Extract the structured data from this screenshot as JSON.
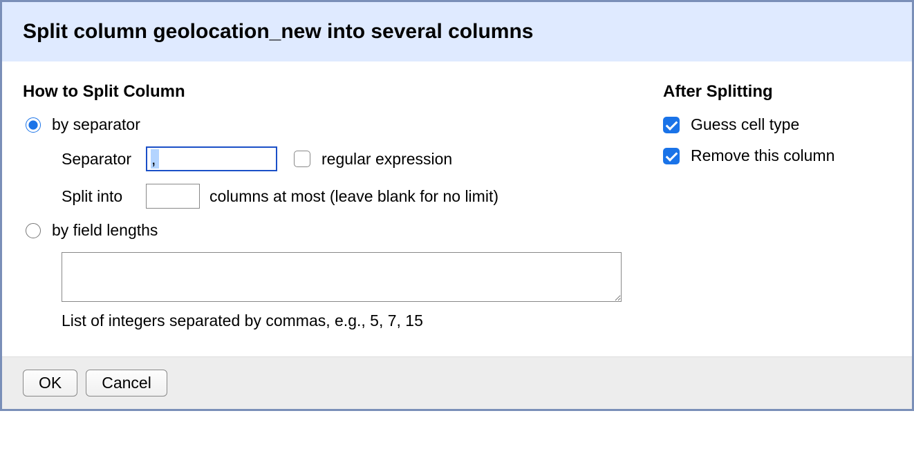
{
  "dialog": {
    "title": "Split column geolocation_new into several columns"
  },
  "left": {
    "heading": "How to Split Column",
    "by_separator_label": "by separator",
    "separator_label": "Separator",
    "separator_value": ",",
    "regex_label": "regular expression",
    "split_into_label": "Split into",
    "split_into_after": "columns at most (leave blank for no limit)",
    "by_lengths_label": "by field lengths",
    "lengths_hint": "List of integers separated by commas, e.g., 5, 7, 15"
  },
  "right": {
    "heading": "After Splitting",
    "guess_label": "Guess cell type",
    "remove_label": "Remove this column"
  },
  "footer": {
    "ok": "OK",
    "cancel": "Cancel"
  }
}
